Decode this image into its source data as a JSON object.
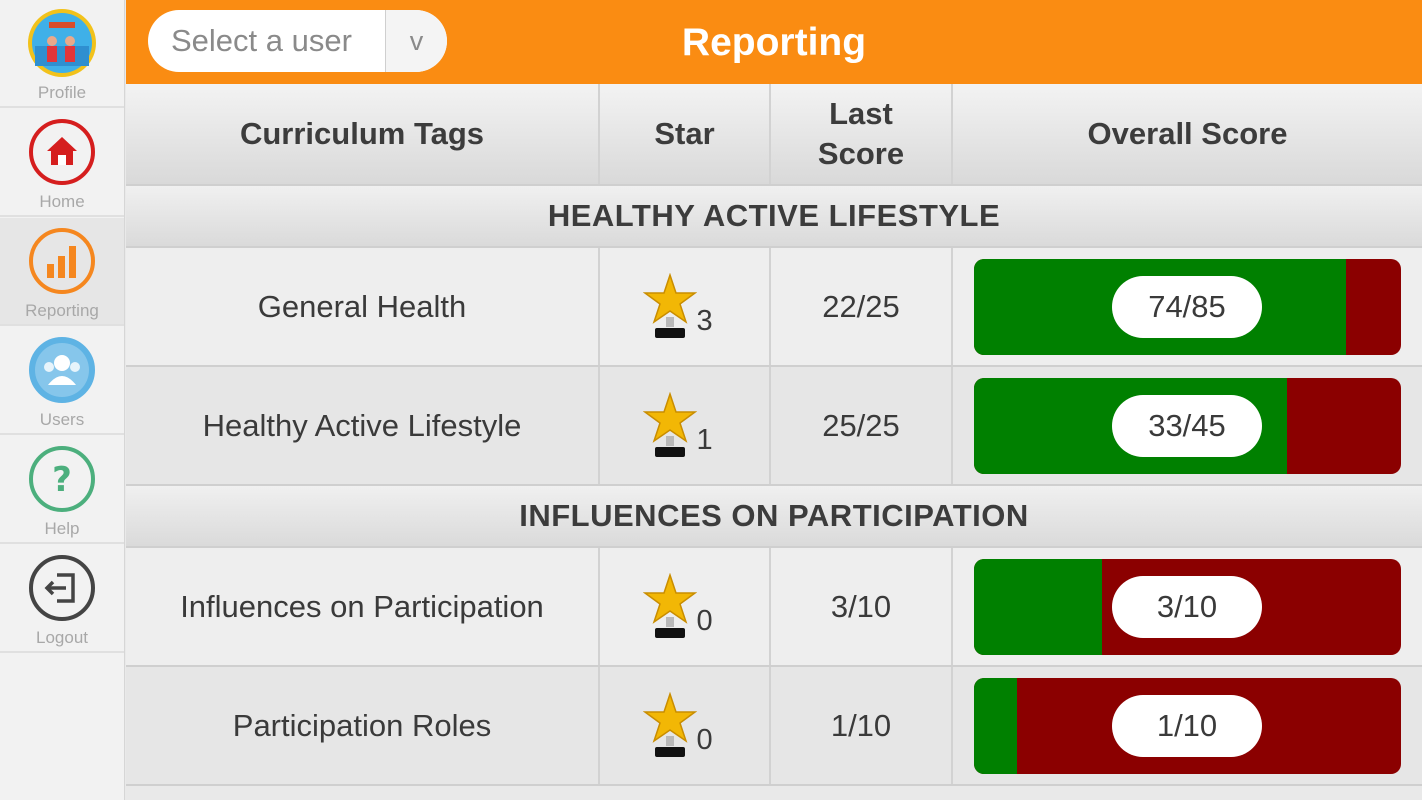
{
  "sidebar": {
    "items": [
      {
        "label": "Profile",
        "icon": "profile-avatar-icon"
      },
      {
        "label": "Home",
        "icon": "home-icon",
        "color": "#d51e1e"
      },
      {
        "label": "Reporting",
        "icon": "bar-chart-icon",
        "color": "#f5871f",
        "active": true
      },
      {
        "label": "Users",
        "icon": "users-icon",
        "color": "#5eb3e4"
      },
      {
        "label": "Help",
        "icon": "question-icon",
        "color": "#4caf7d"
      },
      {
        "label": "Logout",
        "icon": "logout-icon",
        "color": "#444444"
      }
    ]
  },
  "header": {
    "title": "Reporting",
    "user_select": {
      "placeholder": "Select a user",
      "arrow": "v"
    },
    "color": "#fa8c12"
  },
  "table": {
    "columns": [
      "Curriculum Tags",
      "Star",
      "Last Score",
      "Overall Score"
    ],
    "sections": [
      {
        "title": "HEALTHY ACTIVE LIFESTYLE",
        "rows": [
          {
            "tag": "General Health",
            "stars": "3",
            "last_score": "22/25",
            "overall": "74/85",
            "fill_fraction": 0.871
          },
          {
            "tag": "Healthy Active Lifestyle",
            "stars": "1",
            "last_score": "25/25",
            "overall": "33/45",
            "fill_fraction": 0.733
          }
        ]
      },
      {
        "title": "INFLUENCES ON PARTICIPATION",
        "rows": [
          {
            "tag": "Influences on Participation",
            "stars": "0",
            "last_score": "3/10",
            "overall": "3/10",
            "fill_fraction": 0.3
          },
          {
            "tag": "Participation Roles",
            "stars": "0",
            "last_score": "1/10",
            "overall": "1/10",
            "fill_fraction": 0.1
          }
        ]
      }
    ]
  },
  "colors": {
    "score_good": "#008000",
    "score_bad": "#8b0000",
    "star": "#f2b705"
  }
}
